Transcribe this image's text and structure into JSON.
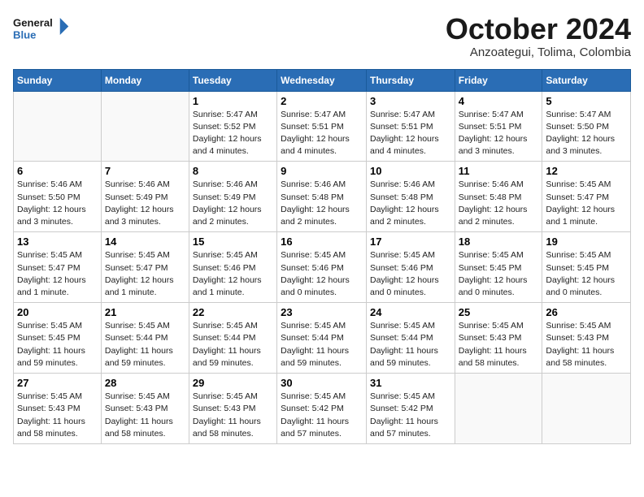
{
  "header": {
    "logo_line1": "General",
    "logo_line2": "Blue",
    "month": "October 2024",
    "location": "Anzoategui, Tolima, Colombia"
  },
  "weekdays": [
    "Sunday",
    "Monday",
    "Tuesday",
    "Wednesday",
    "Thursday",
    "Friday",
    "Saturday"
  ],
  "weeks": [
    [
      {
        "day": "",
        "info": ""
      },
      {
        "day": "",
        "info": ""
      },
      {
        "day": "1",
        "info": "Sunrise: 5:47 AM\nSunset: 5:52 PM\nDaylight: 12 hours\nand 4 minutes."
      },
      {
        "day": "2",
        "info": "Sunrise: 5:47 AM\nSunset: 5:51 PM\nDaylight: 12 hours\nand 4 minutes."
      },
      {
        "day": "3",
        "info": "Sunrise: 5:47 AM\nSunset: 5:51 PM\nDaylight: 12 hours\nand 4 minutes."
      },
      {
        "day": "4",
        "info": "Sunrise: 5:47 AM\nSunset: 5:51 PM\nDaylight: 12 hours\nand 3 minutes."
      },
      {
        "day": "5",
        "info": "Sunrise: 5:47 AM\nSunset: 5:50 PM\nDaylight: 12 hours\nand 3 minutes."
      }
    ],
    [
      {
        "day": "6",
        "info": "Sunrise: 5:46 AM\nSunset: 5:50 PM\nDaylight: 12 hours\nand 3 minutes."
      },
      {
        "day": "7",
        "info": "Sunrise: 5:46 AM\nSunset: 5:49 PM\nDaylight: 12 hours\nand 3 minutes."
      },
      {
        "day": "8",
        "info": "Sunrise: 5:46 AM\nSunset: 5:49 PM\nDaylight: 12 hours\nand 2 minutes."
      },
      {
        "day": "9",
        "info": "Sunrise: 5:46 AM\nSunset: 5:48 PM\nDaylight: 12 hours\nand 2 minutes."
      },
      {
        "day": "10",
        "info": "Sunrise: 5:46 AM\nSunset: 5:48 PM\nDaylight: 12 hours\nand 2 minutes."
      },
      {
        "day": "11",
        "info": "Sunrise: 5:46 AM\nSunset: 5:48 PM\nDaylight: 12 hours\nand 2 minutes."
      },
      {
        "day": "12",
        "info": "Sunrise: 5:45 AM\nSunset: 5:47 PM\nDaylight: 12 hours\nand 1 minute."
      }
    ],
    [
      {
        "day": "13",
        "info": "Sunrise: 5:45 AM\nSunset: 5:47 PM\nDaylight: 12 hours\nand 1 minute."
      },
      {
        "day": "14",
        "info": "Sunrise: 5:45 AM\nSunset: 5:47 PM\nDaylight: 12 hours\nand 1 minute."
      },
      {
        "day": "15",
        "info": "Sunrise: 5:45 AM\nSunset: 5:46 PM\nDaylight: 12 hours\nand 1 minute."
      },
      {
        "day": "16",
        "info": "Sunrise: 5:45 AM\nSunset: 5:46 PM\nDaylight: 12 hours\nand 0 minutes."
      },
      {
        "day": "17",
        "info": "Sunrise: 5:45 AM\nSunset: 5:46 PM\nDaylight: 12 hours\nand 0 minutes."
      },
      {
        "day": "18",
        "info": "Sunrise: 5:45 AM\nSunset: 5:45 PM\nDaylight: 12 hours\nand 0 minutes."
      },
      {
        "day": "19",
        "info": "Sunrise: 5:45 AM\nSunset: 5:45 PM\nDaylight: 12 hours\nand 0 minutes."
      }
    ],
    [
      {
        "day": "20",
        "info": "Sunrise: 5:45 AM\nSunset: 5:45 PM\nDaylight: 11 hours\nand 59 minutes."
      },
      {
        "day": "21",
        "info": "Sunrise: 5:45 AM\nSunset: 5:44 PM\nDaylight: 11 hours\nand 59 minutes."
      },
      {
        "day": "22",
        "info": "Sunrise: 5:45 AM\nSunset: 5:44 PM\nDaylight: 11 hours\nand 59 minutes."
      },
      {
        "day": "23",
        "info": "Sunrise: 5:45 AM\nSunset: 5:44 PM\nDaylight: 11 hours\nand 59 minutes."
      },
      {
        "day": "24",
        "info": "Sunrise: 5:45 AM\nSunset: 5:44 PM\nDaylight: 11 hours\nand 59 minutes."
      },
      {
        "day": "25",
        "info": "Sunrise: 5:45 AM\nSunset: 5:43 PM\nDaylight: 11 hours\nand 58 minutes."
      },
      {
        "day": "26",
        "info": "Sunrise: 5:45 AM\nSunset: 5:43 PM\nDaylight: 11 hours\nand 58 minutes."
      }
    ],
    [
      {
        "day": "27",
        "info": "Sunrise: 5:45 AM\nSunset: 5:43 PM\nDaylight: 11 hours\nand 58 minutes."
      },
      {
        "day": "28",
        "info": "Sunrise: 5:45 AM\nSunset: 5:43 PM\nDaylight: 11 hours\nand 58 minutes."
      },
      {
        "day": "29",
        "info": "Sunrise: 5:45 AM\nSunset: 5:43 PM\nDaylight: 11 hours\nand 58 minutes."
      },
      {
        "day": "30",
        "info": "Sunrise: 5:45 AM\nSunset: 5:42 PM\nDaylight: 11 hours\nand 57 minutes."
      },
      {
        "day": "31",
        "info": "Sunrise: 5:45 AM\nSunset: 5:42 PM\nDaylight: 11 hours\nand 57 minutes."
      },
      {
        "day": "",
        "info": ""
      },
      {
        "day": "",
        "info": ""
      }
    ]
  ]
}
